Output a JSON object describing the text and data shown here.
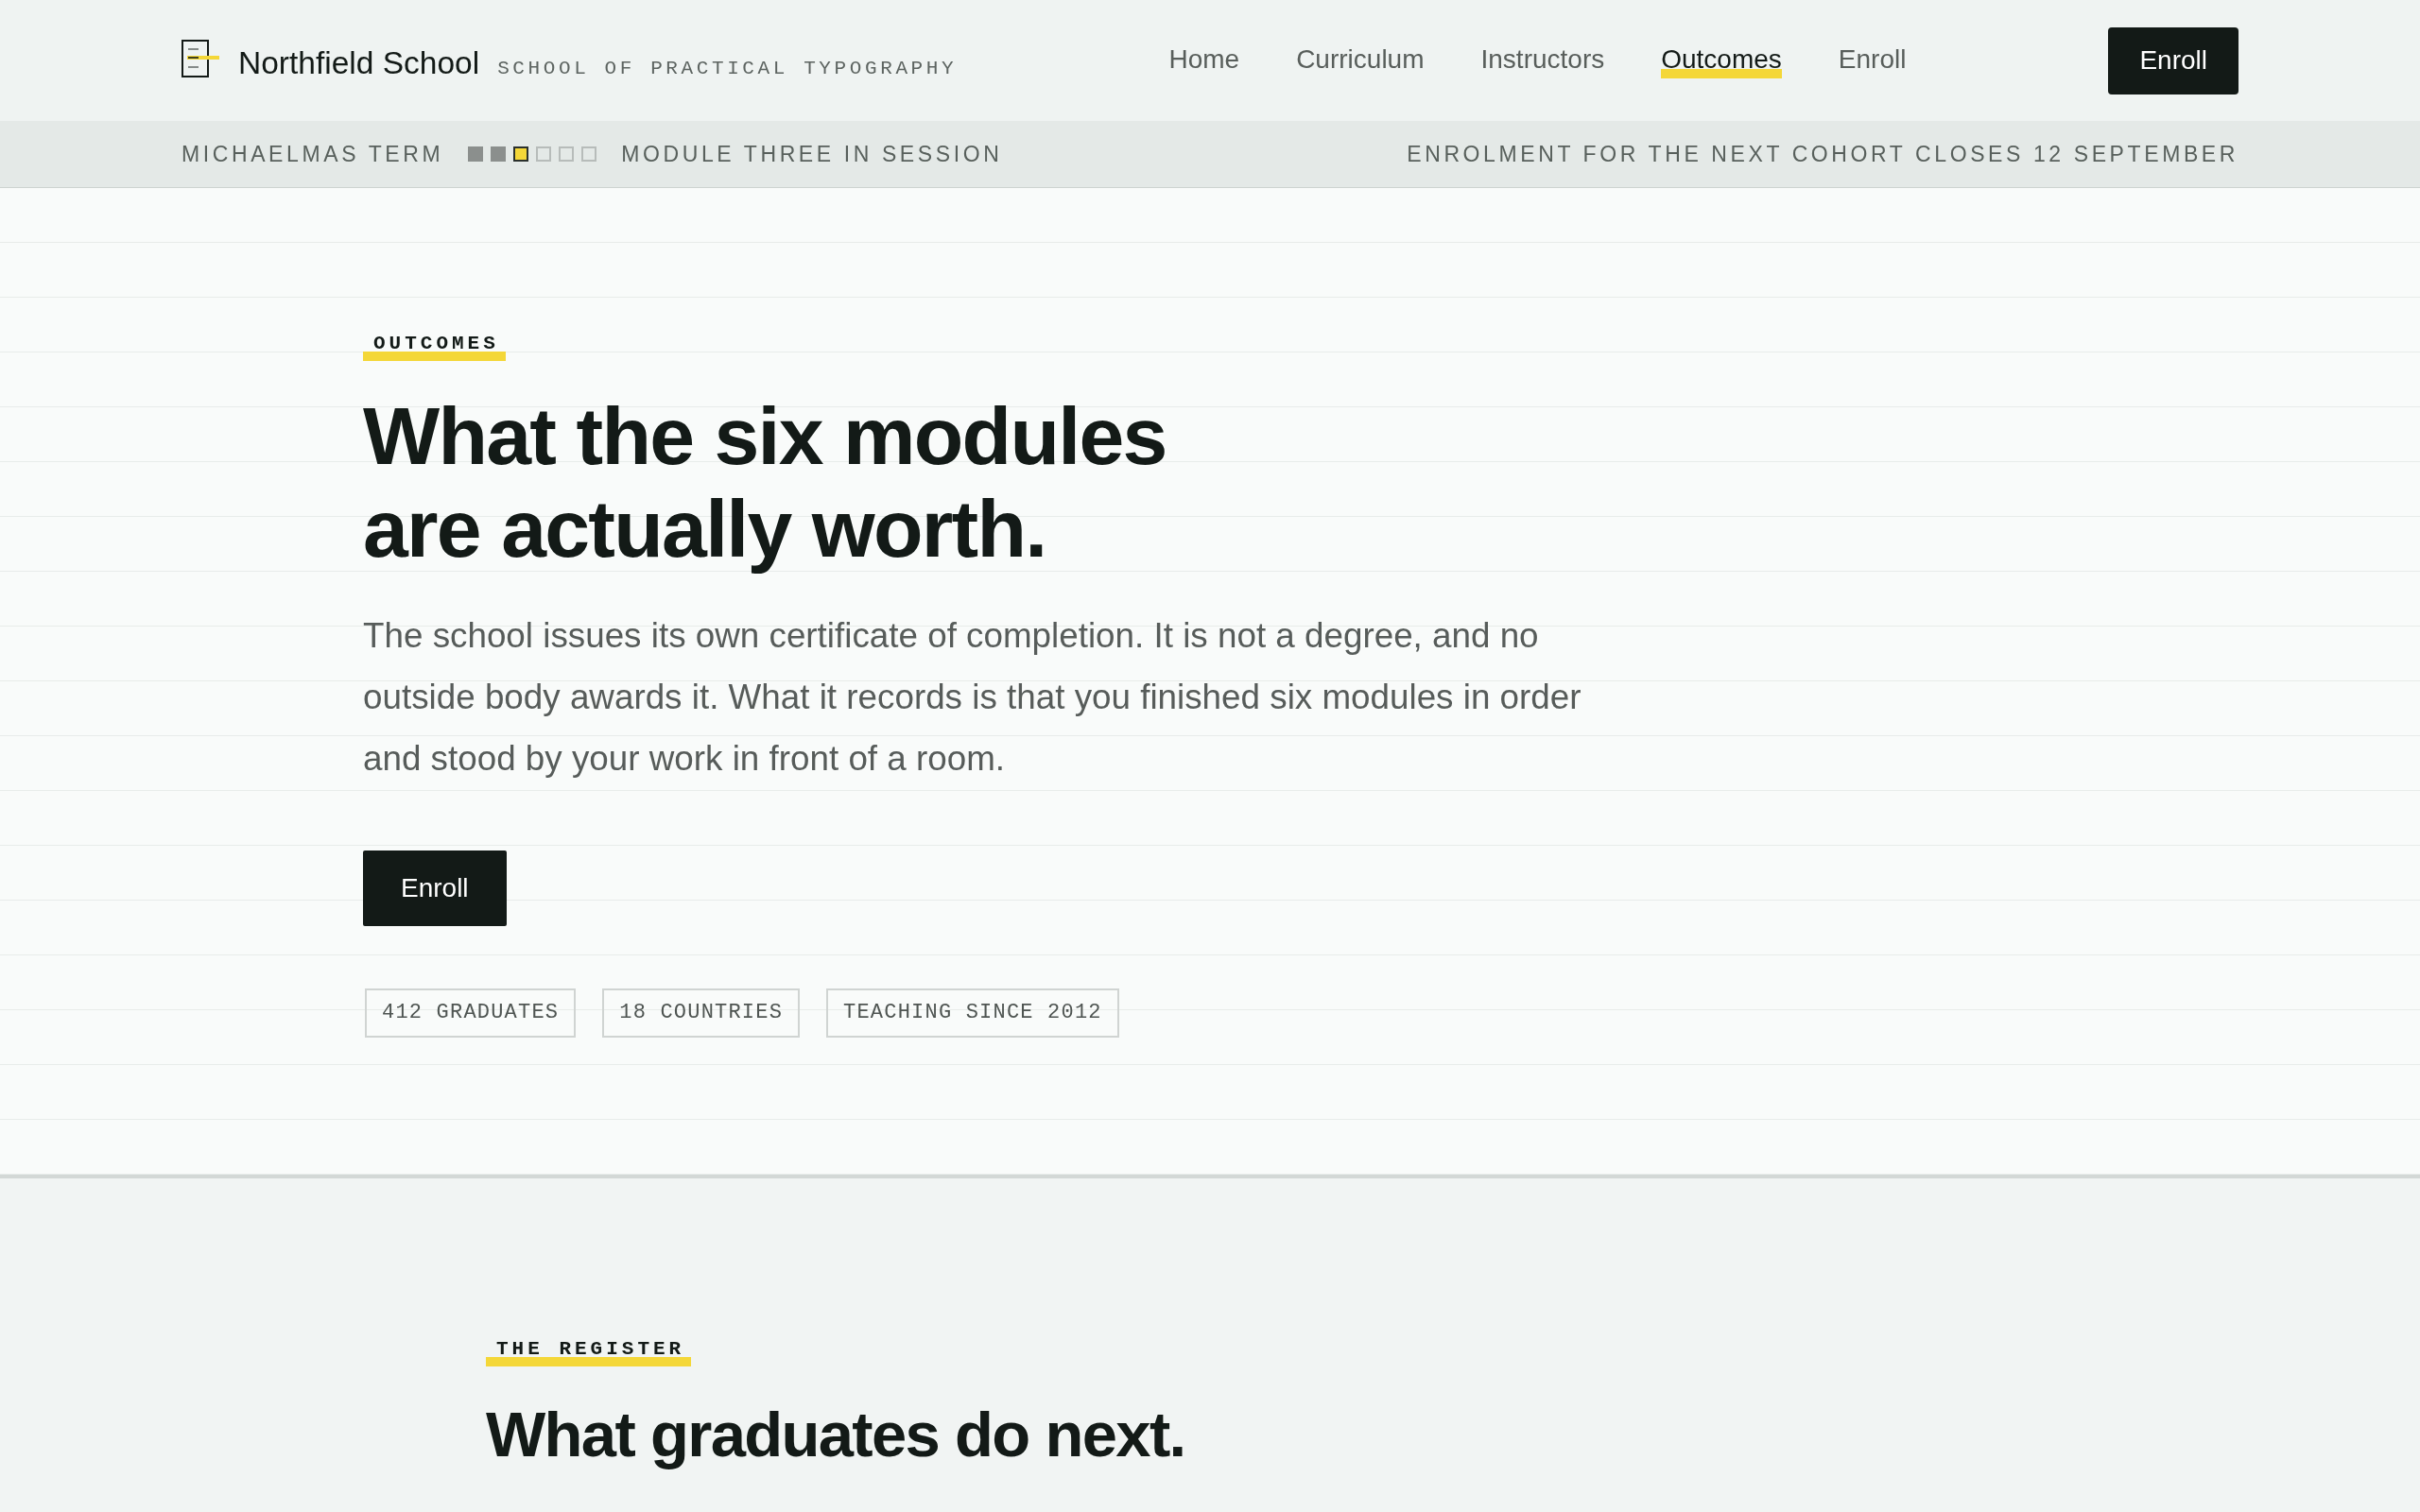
{
  "header": {
    "brand": {
      "name": "Northfield School",
      "tagline": "SCHOOL OF PRACTICAL TYPOGRAPHY"
    },
    "nav": [
      {
        "label": "Home",
        "selected": false
      },
      {
        "label": "Curriculum",
        "selected": false
      },
      {
        "label": "Instructors",
        "selected": false
      },
      {
        "label": "Outcomes",
        "selected": true
      },
      {
        "label": "Enroll",
        "selected": false
      }
    ],
    "button": "Enroll"
  },
  "status_bar": {
    "term": "MICHAELMAS TERM",
    "modules": [
      {
        "completed": true,
        "current": false
      },
      {
        "completed": true,
        "current": false
      },
      {
        "completed": false,
        "current": true
      },
      {
        "completed": false,
        "current": false
      },
      {
        "completed": false,
        "current": false
      },
      {
        "completed": false,
        "current": false
      }
    ],
    "session": "MODULE THREE IN SESSION",
    "notice": "ENROLMENT FOR THE NEXT COHORT CLOSES 12 SEPTEMBER"
  },
  "hero": {
    "eyebrow": "OUTCOMES",
    "heading": "What the six modules are actually worth.",
    "body": "The school issues its own certificate of completion. It is not a degree, and no outside body awards it. What it records is that you finished six modules in order and stood by your work in front of a room.",
    "button": "Enroll",
    "stats": [
      "412 GRADUATES",
      "18 COUNTRIES",
      "TEACHING SINCE 2012"
    ]
  },
  "register": {
    "eyebrow": "THE REGISTER",
    "heading": "What graduates do next."
  }
}
